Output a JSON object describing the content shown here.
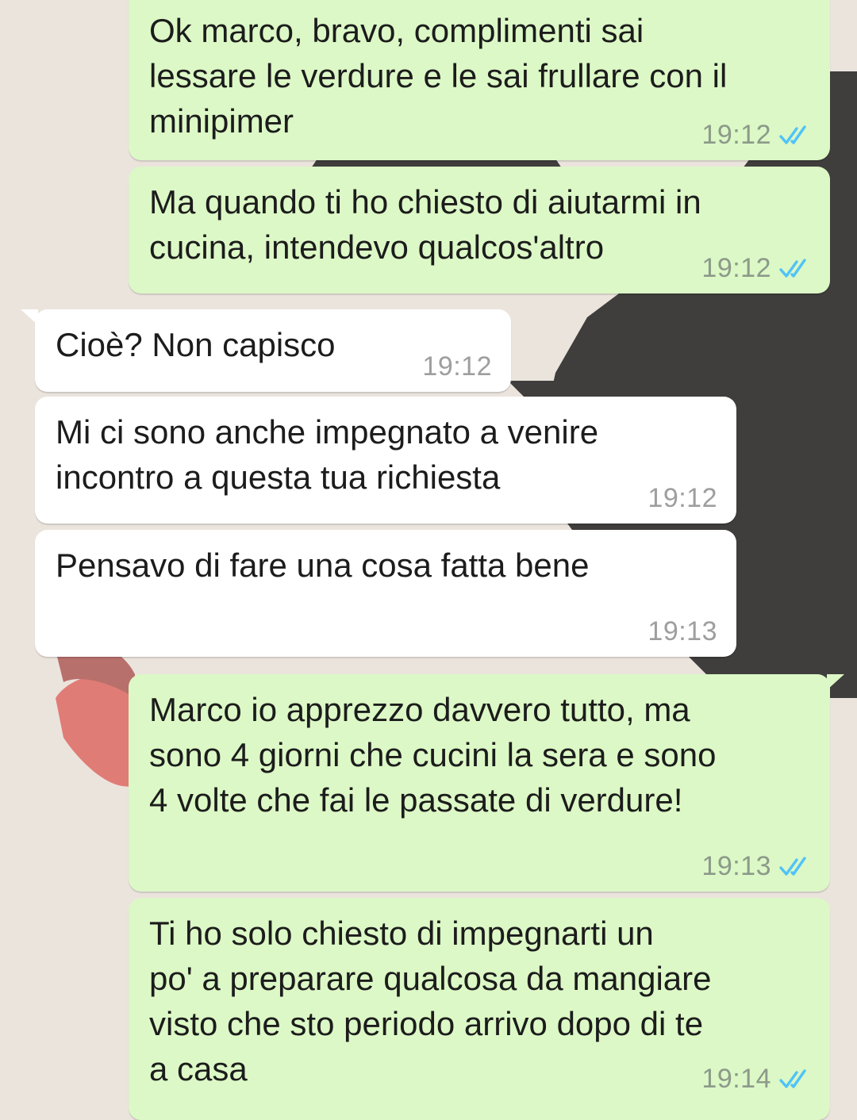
{
  "colors": {
    "outgoing_bubble": "#dcf8c6",
    "incoming_bubble": "#ffffff",
    "read_tick": "#4fc3f7",
    "background": "#ebe4dd"
  },
  "messages": [
    {
      "direction": "outgoing",
      "text": "Ok marco, bravo, complimenti sai\nlessare le verdure e le sai frullare con il\nminipimer",
      "time": "19:12",
      "status": "read",
      "status_icon": "double-check-icon"
    },
    {
      "direction": "outgoing",
      "text": "Ma quando ti ho chiesto di aiutarmi in\ncucina, intendevo qualcos'altro",
      "time": "19:12",
      "status": "read",
      "status_icon": "double-check-icon"
    },
    {
      "direction": "incoming",
      "text": "Cioè? Non capisco",
      "time": "19:12"
    },
    {
      "direction": "incoming",
      "text": "Mi ci sono anche impegnato a venire\nincontro a questa tua richiesta",
      "time": "19:12"
    },
    {
      "direction": "incoming",
      "text": "Pensavo di fare una cosa fatta bene",
      "time": "19:13"
    },
    {
      "direction": "outgoing",
      "text": "Marco io apprezzo davvero tutto, ma\nsono 4 giorni che cucini la sera e sono\n4 volte che fai le passate di verdure!",
      "time": "19:13",
      "status": "read",
      "status_icon": "double-check-icon"
    },
    {
      "direction": "outgoing",
      "text": "Ti ho solo chiesto di impegnarti un\npo' a preparare qualcosa da mangiare\nvisto che sto periodo arrivo dopo di te\na casa",
      "time": "19:14",
      "status": "read",
      "status_icon": "double-check-icon"
    }
  ]
}
